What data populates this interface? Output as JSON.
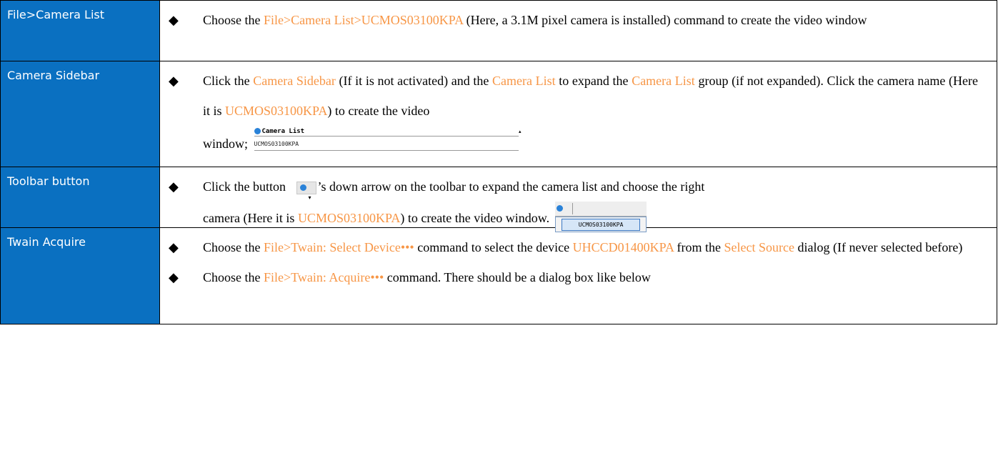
{
  "rows": [
    {
      "header": "File>Camera List",
      "text": {
        "p1": "Choose the ",
        "h1": "File>Camera List>UCMOS03100KPA",
        "p2": " (Here, a 3.1M pixel camera is installed) command to create the video window"
      }
    },
    {
      "header": "Camera Sidebar",
      "text": {
        "p1": "Click the ",
        "h1": "Camera Sidebar",
        "p2": " (If it is not activated) and the ",
        "h2": "Camera List",
        "p3": " to expand the ",
        "h3": "Camera List",
        "p4": " group (if not expanded). Click the camera name (Here it is ",
        "h4": "UCMOS03100KPA",
        "p5": ") to create the video",
        "p6": "window;"
      },
      "panel": {
        "title": "Camera List",
        "item": "UCMOS03100KPA",
        "icon": "camera-icon",
        "collapse_icon": "triangle-up-icon"
      }
    },
    {
      "header": "Toolbar button",
      "text": {
        "p1": "Click the button ",
        "p2": "’s down arrow on the toolbar to expand the camera list and choose the right",
        "p3": "camera (Here it is ",
        "h1": "UCMOS03100KPA",
        "p4": ") to create the video window."
      },
      "dropdown": {
        "item": "UCMOS03100KPA",
        "icon": "camera-icon",
        "arrow_icon": "chevron-down-icon"
      }
    },
    {
      "header": "Twain Acquire",
      "b1": {
        "p1": "Choose the ",
        "h1": "File>Twain: Select Device•••",
        "p2": " command to select the device ",
        "h2": "UHCCD01400KPA",
        "p3": " from the ",
        "h3": "Select Source",
        "p4": " dialog (If never selected before)"
      },
      "b2": {
        "p1": "Choose the ",
        "h1": "File>Twain: Acquire•••",
        "p2": " command. There should be a dialog box like below"
      }
    }
  ],
  "bullet": "◆",
  "colors": {
    "header_bg": "#0a70c1",
    "highlight": "#f79646",
    "border": "#000000"
  }
}
